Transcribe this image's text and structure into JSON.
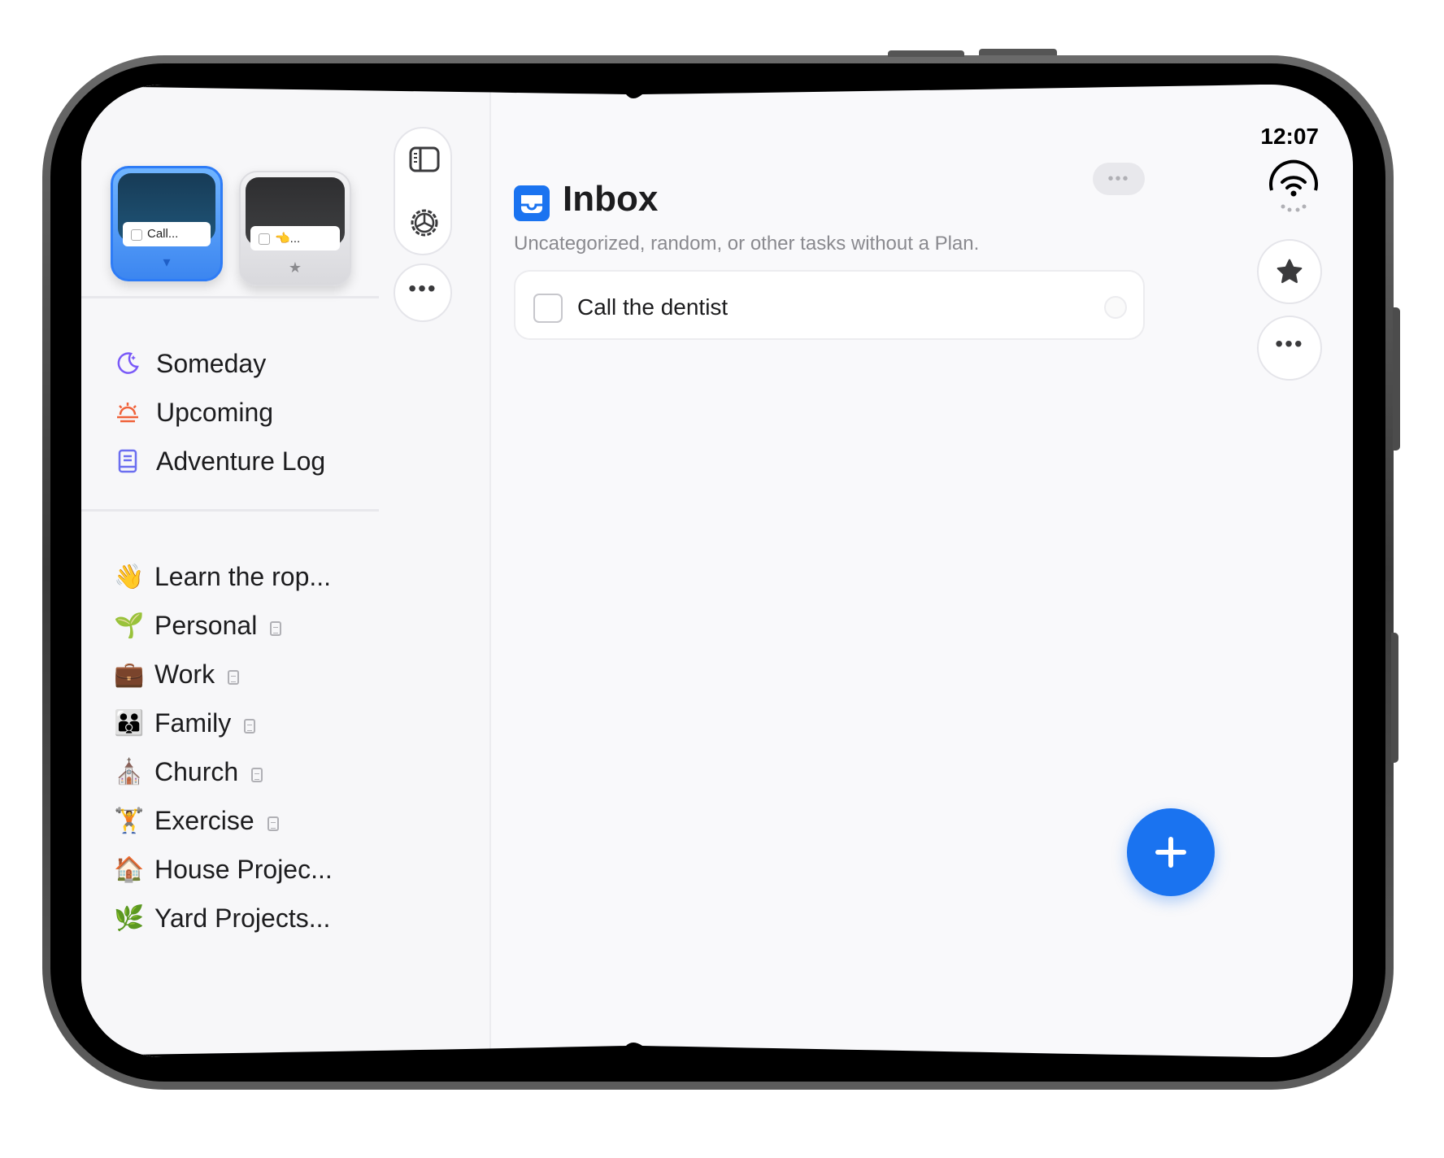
{
  "sidebar": {
    "thumbnails": [
      {
        "card_text": "Call...",
        "selected": true
      },
      {
        "card_text": "👈...",
        "selected": false
      }
    ],
    "smart_lists": [
      {
        "label": "Someday",
        "icon": "moon-icon",
        "color": "#7a5af8"
      },
      {
        "label": "Upcoming",
        "icon": "sunrise-icon",
        "color": "#f0623a"
      },
      {
        "label": "Adventure Log",
        "icon": "book-icon",
        "color": "#6b6ef0"
      }
    ],
    "plans": [
      {
        "label": "Learn the rop...",
        "emoji": "👋",
        "note": false
      },
      {
        "label": "Personal",
        "emoji": "🌱",
        "note": true
      },
      {
        "label": "Work",
        "emoji": "💼",
        "note": true
      },
      {
        "label": "Family",
        "emoji": "👪",
        "note": true
      },
      {
        "label": "Church",
        "emoji": "⛪",
        "note": true
      },
      {
        "label": "Exercise",
        "emoji": "🏋",
        "note": true
      },
      {
        "label": "House Projec...",
        "emoji": "🏠",
        "note": false
      },
      {
        "label": "Yard Projects...",
        "emoji": "🌿",
        "note": false
      }
    ]
  },
  "main": {
    "title": "Inbox",
    "subtitle": "Uncategorized, random, or other tasks without a Plan.",
    "tasks": [
      {
        "text": "Call the dentist",
        "done": false
      }
    ]
  },
  "status": {
    "time": "12:07"
  },
  "colors": {
    "accent": "#1a73f0"
  }
}
